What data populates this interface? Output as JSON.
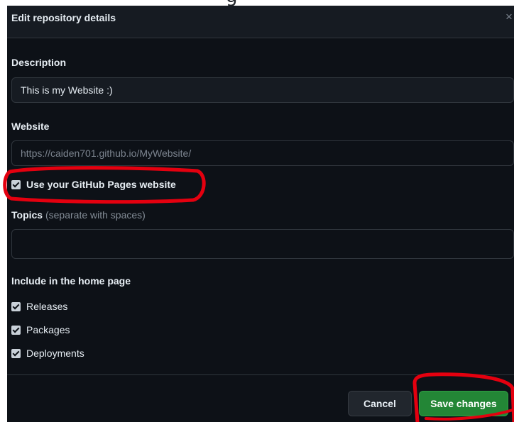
{
  "page_fragment_text": "g",
  "dialog": {
    "title": "Edit repository details",
    "close_icon": "×"
  },
  "description": {
    "label": "Description",
    "value": "This is my Website :)"
  },
  "website": {
    "label": "Website",
    "placeholder": "https://caiden701.github.io/MyWebsite/",
    "use_pages_label": "Use your GitHub Pages website",
    "use_pages_checked": true
  },
  "topics": {
    "label": "Topics",
    "hint": "(separate with spaces)",
    "value": ""
  },
  "home_page": {
    "label": "Include in the home page",
    "items": [
      {
        "label": "Releases",
        "checked": true
      },
      {
        "label": "Packages",
        "checked": true
      },
      {
        "label": "Deployments",
        "checked": true
      }
    ]
  },
  "footer": {
    "cancel_label": "Cancel",
    "save_label": "Save changes"
  },
  "annotation_color": "#e4000f"
}
